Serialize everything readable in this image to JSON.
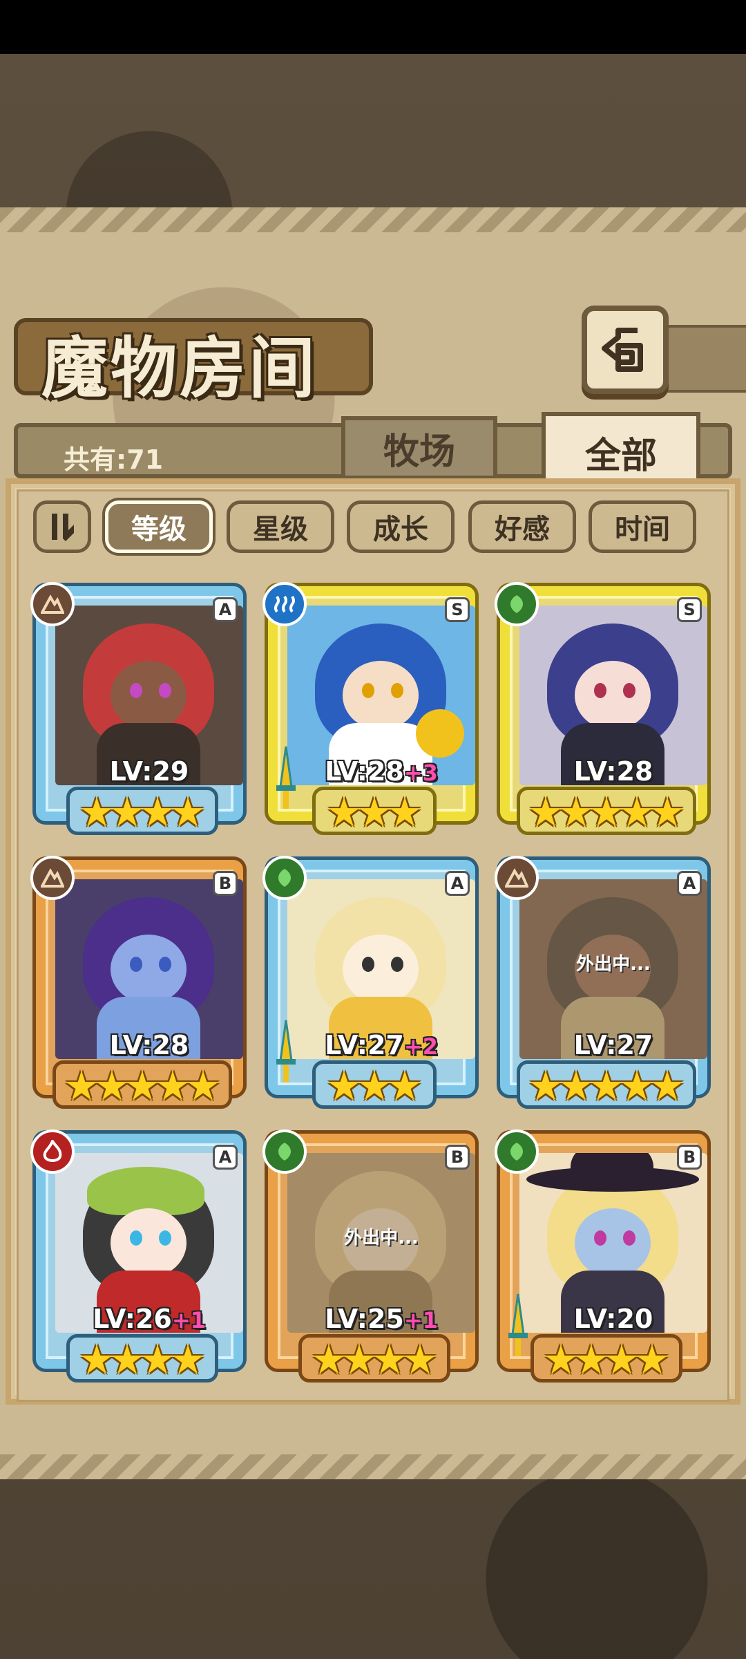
{
  "header": {
    "title": "魔物房间"
  },
  "tabs": {
    "count_label": "共有:71",
    "ranch": "牧场",
    "all": "全部"
  },
  "sort": {
    "level": "等级",
    "star": "星级",
    "growth": "成长",
    "affection": "好感",
    "time": "时间"
  },
  "colors": {
    "frame_A": "#7fc7e8",
    "frame_S": "#f0df3a",
    "frame_B": "#e9a047",
    "parchment": "#cbb994"
  },
  "monsters": [
    {
      "rank": "A",
      "element": "rock-icon",
      "level": "LV:29",
      "plus": "",
      "stars": "★★★★",
      "away": ""
    },
    {
      "rank": "S",
      "element": "water-icon",
      "level": "LV:28",
      "plus": "+3",
      "stars": "★★★",
      "away": ""
    },
    {
      "rank": "S",
      "element": "leaf-icon",
      "level": "LV:28",
      "plus": "",
      "stars": "★★★★★",
      "away": ""
    },
    {
      "rank": "B",
      "element": "rock-icon",
      "level": "LV:28",
      "plus": "",
      "stars": "★★★★★",
      "away": ""
    },
    {
      "rank": "A",
      "element": "leaf-icon",
      "level": "LV:27",
      "plus": "+2",
      "stars": "★★★",
      "away": ""
    },
    {
      "rank": "A",
      "element": "rock-icon",
      "level": "LV:27",
      "plus": "",
      "stars": "★★★★★",
      "away": "外出中..."
    },
    {
      "rank": "A",
      "element": "fire-icon",
      "level": "LV:26",
      "plus": "+1",
      "stars": "★★★★",
      "away": ""
    },
    {
      "rank": "B",
      "element": "leaf-icon",
      "level": "LV:25",
      "plus": "+1",
      "stars": "★★★★",
      "away": "外出中..."
    },
    {
      "rank": "B",
      "element": "leaf-icon",
      "level": "LV:20",
      "plus": "",
      "stars": "★★★★",
      "away": ""
    }
  ]
}
